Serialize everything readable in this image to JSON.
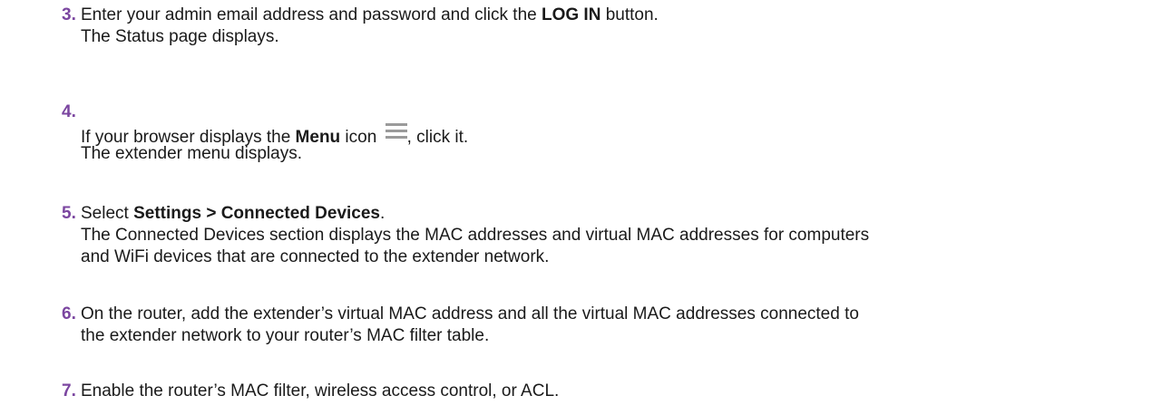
{
  "steps": [
    {
      "number": "3.",
      "pre": "Enter your admin email address and password and click the ",
      "bold": "LOG IN",
      "post": " button.",
      "result": "The Status page displays."
    },
    {
      "number": "4.",
      "pre": "If your browser displays the ",
      "bold": "Menu",
      "mid": " icon ",
      "icon": "menu-icon",
      "post": ", click it.",
      "result": "The extender menu displays."
    },
    {
      "number": "5.",
      "pre": "Select ",
      "bold": "Settings > Connected Devices",
      "post": ".",
      "result_line1": "The Connected Devices section displays the MAC addresses and virtual MAC addresses for computers",
      "result_line2": "and WiFi devices that are connected to the extender network."
    },
    {
      "number": "6.",
      "line1": "On the router, add the extender’s virtual MAC address and all the virtual MAC addresses connected to",
      "line2": "the extender network to your router’s MAC filter table."
    },
    {
      "number": "7.",
      "line1": "Enable the router’s MAC filter, wireless access control, or ACL."
    }
  ],
  "colors": {
    "step_number": "#7b46a0",
    "text": "#1a1a1a",
    "icon": "#9a9a9a"
  }
}
